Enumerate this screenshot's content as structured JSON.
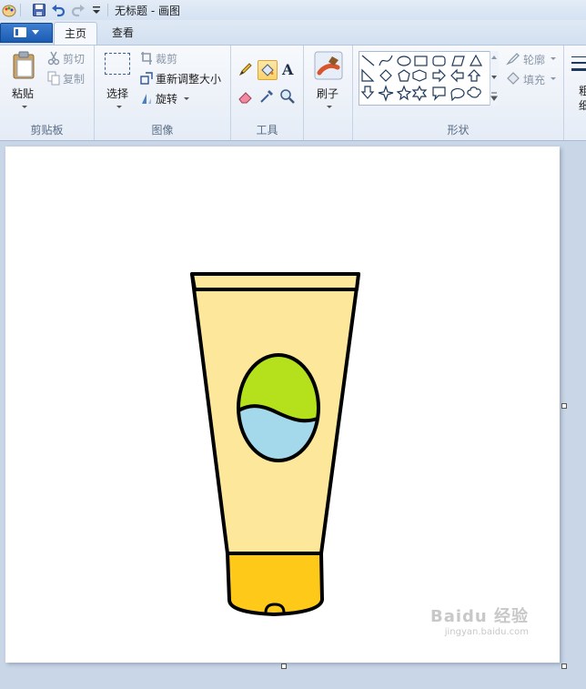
{
  "window": {
    "title": "无标题 - 画图"
  },
  "tabs": [
    {
      "label": "主页"
    },
    {
      "label": "查看"
    }
  ],
  "clipboard": {
    "paste": "粘贴",
    "cut": "剪切",
    "copy": "复制",
    "group": "剪贴板"
  },
  "image": {
    "select": "选择",
    "crop": "裁剪",
    "resize": "重新调整大小",
    "rotate": "旋转",
    "group": "图像"
  },
  "tools": {
    "group": "工具",
    "selected": "fill-bucket"
  },
  "brushes": {
    "label": "刷子"
  },
  "shapes": {
    "group": "形状",
    "outline": "轮廓",
    "fill": "填充",
    "size_partial": "粗细"
  },
  "drawing": {
    "subject": "tube",
    "colors": {
      "tube_body": "#fde79b",
      "cap": "#ffc91a",
      "label_top": "#b5e11c",
      "label_bottom": "#a3d9eb",
      "outline": "#000000"
    }
  },
  "watermark": {
    "text": "Baidu 经验",
    "subtext": "jingyan.baidu.com"
  }
}
